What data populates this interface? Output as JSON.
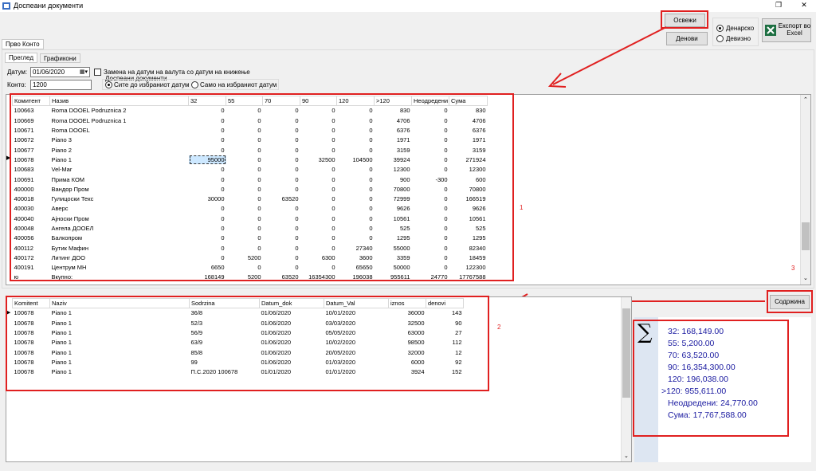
{
  "window": {
    "title": "Доспеани документи",
    "restore_glyph": "❐",
    "close_glyph": "✕"
  },
  "toolbar": {
    "refresh_label": "Освежи",
    "days_label": "Денови",
    "currency_denar_label": "Денарско",
    "currency_foreign_label": "Девизно",
    "export_label_1": "Експорт во",
    "export_label_2": "Excel"
  },
  "outer_tab": "Прво Конто",
  "inner_tabs": [
    "Преглед",
    "Графикони"
  ],
  "filters": {
    "date_label": "Датум:",
    "date_value": "01/06/2020",
    "account_label": "Конто:",
    "account_value": "1200",
    "replace_date_label": "Замена на датум на валута со датум на книжење",
    "due_docs_label": "Доспеани документи",
    "radio_all_label": "Сите до избраниот датум",
    "radio_only_label": "Само на избраниот датум"
  },
  "main_grid": {
    "columns": [
      "Комитент",
      "Назив",
      "32",
      "55",
      "70",
      "90",
      "120",
      ">120",
      "Неодредени",
      "Сума"
    ],
    "rows": [
      [
        "100663",
        "Roma DOOEL Podruznica 2",
        "0",
        "0",
        "0",
        "0",
        "0",
        "830",
        "0",
        "830"
      ],
      [
        "100669",
        "Roma DOOEL Podruznica 1",
        "0",
        "0",
        "0",
        "0",
        "0",
        "4706",
        "0",
        "4706"
      ],
      [
        "100671",
        "Roma DOOEL",
        "0",
        "0",
        "0",
        "0",
        "0",
        "6376",
        "0",
        "6376"
      ],
      [
        "100672",
        "Piano 3",
        "0",
        "0",
        "0",
        "0",
        "0",
        "1971",
        "0",
        "1971"
      ],
      [
        "100677",
        "Piano 2",
        "0",
        "0",
        "0",
        "0",
        "0",
        "3159",
        "0",
        "3159"
      ],
      [
        "100678",
        "Piano 1",
        "95000",
        "0",
        "0",
        "32500",
        "104500",
        "39924",
        "0",
        "271924"
      ],
      [
        "100683",
        "Vel-Mar",
        "0",
        "0",
        "0",
        "0",
        "0",
        "12300",
        "0",
        "12300"
      ],
      [
        "100691",
        "Прима КОМ",
        "0",
        "0",
        "0",
        "0",
        "0",
        "900",
        "-300",
        "600"
      ],
      [
        "400000",
        "Вандор Пром",
        "0",
        "0",
        "0",
        "0",
        "0",
        "70800",
        "0",
        "70800"
      ],
      [
        "400018",
        "Гулицоски Текс",
        "30000",
        "0",
        "63520",
        "0",
        "0",
        "72999",
        "0",
        "166519"
      ],
      [
        "400030",
        "Аверс",
        "0",
        "0",
        "0",
        "0",
        "0",
        "9626",
        "0",
        "9626"
      ],
      [
        "400040",
        "Ајноски Пром",
        "0",
        "0",
        "0",
        "0",
        "0",
        "10561",
        "0",
        "10561"
      ],
      [
        "400048",
        "Ангела ДООЕЛ",
        "0",
        "0",
        "0",
        "0",
        "0",
        "525",
        "0",
        "525"
      ],
      [
        "400056",
        "Балкопром",
        "0",
        "0",
        "0",
        "0",
        "0",
        "1295",
        "0",
        "1295"
      ],
      [
        "400112",
        "Бутик Мафин",
        "0",
        "0",
        "0",
        "0",
        "27340",
        "55000",
        "0",
        "82340"
      ],
      [
        "400172",
        "Литинг ДОО",
        "0",
        "5200",
        "0",
        "6300",
        "3600",
        "3359",
        "0",
        "18459"
      ],
      [
        "400191",
        "Центрум МН",
        "6650",
        "0",
        "0",
        "0",
        "65650",
        "50000",
        "0",
        "122300"
      ],
      [
        "ю",
        "Вкупно:",
        "168149",
        "5200",
        "63520",
        "16354300",
        "196038",
        "955611",
        "24770",
        "17767588"
      ]
    ]
  },
  "detail_grid": {
    "columns": [
      "Komitent",
      "Naziv",
      "Sodrzina",
      "Datum_dok",
      "Datum_Val",
      "iznos",
      "denovi"
    ],
    "rows": [
      [
        "100678",
        "Piano 1",
        "36/8",
        "01/06/2020",
        "10/01/2020",
        "36000",
        "143"
      ],
      [
        "100678",
        "Piano 1",
        "52/3",
        "01/06/2020",
        "03/03/2020",
        "32500",
        "90"
      ],
      [
        "100678",
        "Piano 1",
        "56/9",
        "01/06/2020",
        "05/05/2020",
        "63000",
        "27"
      ],
      [
        "100678",
        "Piano 1",
        "63/9",
        "01/06/2020",
        "10/02/2020",
        "98500",
        "112"
      ],
      [
        "100678",
        "Piano 1",
        "85/8",
        "01/06/2020",
        "20/05/2020",
        "32000",
        "12"
      ],
      [
        "100678",
        "Piano 1",
        "99",
        "01/06/2020",
        "01/03/2020",
        "6000",
        "92"
      ],
      [
        "100678",
        "Piano 1",
        "П.С.2020 100678",
        "01/01/2020",
        "01/01/2020",
        "3924",
        "152"
      ]
    ]
  },
  "content_button": "Содржина",
  "summary": {
    "sigma": "∑",
    "lines": [
      "32:   168,149.00",
      "55:   5,200.00",
      "70:   63,520.00",
      "90:   16,354,300.00",
      "120:   196,038.00",
      ">120:   955,611.00",
      "Неодредени:   24,770.00",
      "Сума:   17,767,588.00"
    ]
  },
  "annotations": {
    "label_1": "1",
    "label_2": "2",
    "label_3": "3"
  },
  "colors": {
    "annotation_red": "#e02020",
    "summary_blue": "#1a1aa0",
    "selection": "#cde8ff"
  }
}
